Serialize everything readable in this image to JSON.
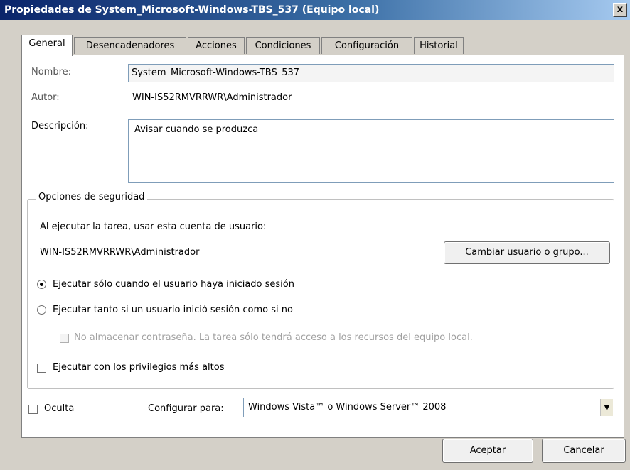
{
  "window": {
    "title": "Propiedades de System_Microsoft-Windows-TBS_537 (Equipo local)",
    "close_glyph": "x"
  },
  "tabs": [
    {
      "label": "General",
      "active": true
    },
    {
      "label": "Desencadenadores"
    },
    {
      "label": "Acciones"
    },
    {
      "label": "Condiciones"
    },
    {
      "label": "Configuración"
    },
    {
      "label": "Historial"
    }
  ],
  "general": {
    "name_label": "Nombre:",
    "name_value": "System_Microsoft-Windows-TBS_537",
    "author_label": "Autor:",
    "author_value": "WIN-IS52RMVRRWR\\Administrador",
    "description_label": "Descripción:",
    "description_value": "Avisar cuando se produzca"
  },
  "security": {
    "group_title": "Opciones de seguridad",
    "account_prompt": "Al ejecutar la tarea, usar esta cuenta de usuario:",
    "account_value": "WIN-IS52RMVRRWR\\Administrador",
    "change_user_button": "Cambiar usuario o grupo...",
    "radio_logged_on": "Ejecutar sólo cuando el usuario haya iniciado sesión",
    "radio_logged_on_selected": true,
    "radio_any": "Ejecutar tanto si un usuario inició sesión como si no",
    "no_store_password": "No almacenar contraseña. La tarea sólo tendrá acceso a los recursos del equipo local.",
    "highest_privileges": "Ejecutar con los privilegios más altos"
  },
  "bottom": {
    "hidden_label": "Oculta",
    "configure_label": "Configurar para:",
    "configure_value": "Windows Vista™ o Windows Server™ 2008",
    "accept_button": "Aceptar",
    "cancel_button": "Cancelar"
  }
}
